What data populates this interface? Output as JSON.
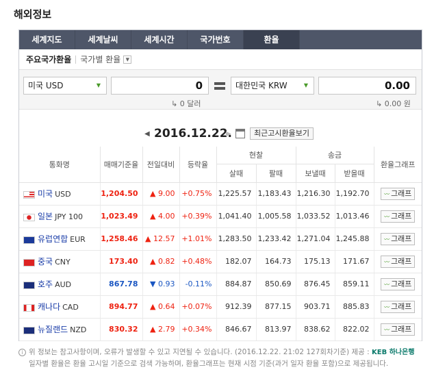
{
  "page": {
    "title": "해외정보"
  },
  "tabs": [
    "세계지도",
    "세계날씨",
    "세계시간",
    "국가번호",
    "환율"
  ],
  "active_tab": "환율",
  "subbar": {
    "main": "주요국가환율",
    "link": "국가별 환율"
  },
  "converter": {
    "from_currency": "미국 USD",
    "from_amount": "0",
    "to_currency": "대한민국 KRW",
    "to_amount": "0.00",
    "from_text": "↳ 0 달러",
    "to_text": "↳ 0.00 원"
  },
  "date": "2016.12.22.",
  "recent_button": "최근고시환율보기",
  "table": {
    "headers": {
      "name": "통화명",
      "base": "매매기준율",
      "change": "전일대비",
      "rate": "등락율",
      "cash": "현찰",
      "cash_buy": "살때",
      "cash_sell": "팔때",
      "remit": "송금",
      "remit_send": "보낼때",
      "remit_recv": "받을때",
      "graph": "환율그래프"
    },
    "rows": [
      {
        "flag": "us",
        "name": "미국",
        "code": "USD",
        "base": "1,204.50",
        "dir": "up",
        "arrow": "▲",
        "change": "9.00",
        "rate": "+0.75%",
        "cash_buy": "1,225.57",
        "cash_sell": "1,183.43",
        "send": "1,216.30",
        "recv": "1,192.70",
        "graph": "그래프"
      },
      {
        "flag": "jp",
        "name": "일본",
        "code": "JPY 100",
        "base": "1,023.49",
        "dir": "up",
        "arrow": "▲",
        "change": "4.00",
        "rate": "+0.39%",
        "cash_buy": "1,041.40",
        "cash_sell": "1,005.58",
        "send": "1,033.52",
        "recv": "1,013.46",
        "graph": "그래프"
      },
      {
        "flag": "eu",
        "name": "유럽연합",
        "code": "EUR",
        "base": "1,258.46",
        "dir": "up",
        "arrow": "▲",
        "change": "12.57",
        "rate": "+1.01%",
        "cash_buy": "1,283.50",
        "cash_sell": "1,233.42",
        "send": "1,271.04",
        "recv": "1,245.88",
        "graph": "그래프"
      },
      {
        "flag": "cn",
        "name": "중국",
        "code": "CNY",
        "base": "173.40",
        "dir": "up",
        "arrow": "▲",
        "change": "0.82",
        "rate": "+0.48%",
        "cash_buy": "182.07",
        "cash_sell": "164.73",
        "send": "175.13",
        "recv": "171.67",
        "graph": "그래프"
      },
      {
        "flag": "au",
        "name": "호주",
        "code": "AUD",
        "base": "867.78",
        "dir": "down",
        "arrow": "▼",
        "change": "0.93",
        "rate": "-0.11%",
        "cash_buy": "884.87",
        "cash_sell": "850.69",
        "send": "876.45",
        "recv": "859.11",
        "graph": "그래프"
      },
      {
        "flag": "ca",
        "name": "캐나다",
        "code": "CAD",
        "base": "894.77",
        "dir": "up",
        "arrow": "▲",
        "change": "0.64",
        "rate": "+0.07%",
        "cash_buy": "912.39",
        "cash_sell": "877.15",
        "send": "903.71",
        "recv": "885.83",
        "graph": "그래프"
      },
      {
        "flag": "nz",
        "name": "뉴질랜드",
        "code": "NZD",
        "base": "830.32",
        "dir": "up",
        "arrow": "▲",
        "change": "2.79",
        "rate": "+0.34%",
        "cash_buy": "846.67",
        "cash_sell": "813.97",
        "send": "838.62",
        "recv": "822.02",
        "graph": "그래프"
      }
    ]
  },
  "notes": {
    "line1": "위 정보는 참고사항이며, 오류가 발생할 수 있고 지연될 수 있습니다. (2016.12.22. 21:02 127회차기준)",
    "provider": "제공 :",
    "bank": "KEB 하나은행",
    "line2": "일자별 환율은 환율 고시일 기준으로 검색 가능하며, 환율그래프는 현재 시점 기준(과거 일자 환율 포함)으로 제공됩니다."
  },
  "colors": {
    "tab_bg": "#4e5668",
    "up": "#e21",
    "down": "#1a56c2"
  }
}
